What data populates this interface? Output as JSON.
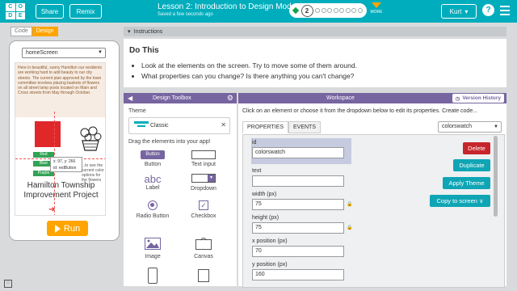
{
  "header": {
    "logo_letters": [
      "C",
      "O",
      "D",
      "E"
    ],
    "share_label": "Share",
    "remix_label": "Remix",
    "lesson_title": "Lesson 2: Introduction to Design Mode",
    "saved_text": "Saved a few seconds ago",
    "current_level": "2",
    "more_label": "MORE",
    "user_name": "Kurt",
    "user_chevron": "▾",
    "help_label": "?"
  },
  "left_panel": {
    "code_tab": "Code",
    "design_tab": "Design",
    "screen_select": "homeScreen",
    "intro_text": "Here in beautiful, sunny Hamilton our residents are working hard to add beauty to our city streets. The current plan approved by the town committee involves placing baskets of flowers on all street lamp posts located on Main and Cross streets from May through October.",
    "color_buttons": [
      "Red",
      "Blue",
      "Purple"
    ],
    "tooltip_line1": "x: 97, y: 266",
    "tooltip_line2": "id: redButton",
    "side_text": "...to see the current color options for the flowers",
    "hamilton_title": "Hamilton Township Improvement Project",
    "run_label": "Run"
  },
  "instructions": {
    "tab_label": "Instructions",
    "heading": "Do This",
    "bullets": [
      "Look at the elements on the screen. Try to move some of them around.",
      "What properties can you change? Is there anything you can't change?"
    ]
  },
  "toolbox": {
    "title": "Design Toolbox",
    "theme_label": "Theme",
    "theme_value": "Classic",
    "drag_label": "Drag the elements into your app!",
    "tools": {
      "button": "Button",
      "button_sample": "Button",
      "text_input": "Text input",
      "label": "Label",
      "label_sample": "abc",
      "dropdown": "Dropdown",
      "radio": "Radio Button",
      "checkbox": "Checkbox",
      "image": "Image",
      "canvas": "Canvas"
    }
  },
  "workspace": {
    "title": "Workspace",
    "version_history": "Version History",
    "hint": "Click on an element or choose it from the dropdown below to edit its properties. Create code...",
    "tab_properties": "PROPERTIES",
    "tab_events": "EVENTS",
    "element_select": "colorswatch",
    "props": {
      "id_label": "id",
      "id_value": "colorswatch",
      "text_label": "text",
      "text_value": "",
      "width_label": "width (px)",
      "width_value": "75",
      "height_label": "height (px)",
      "height_value": "75",
      "x_label": "x position (px)",
      "x_value": "70",
      "y_label": "y position (px)",
      "y_value": "160"
    },
    "delete_label": "Delete",
    "duplicate_label": "Duplicate",
    "apply_theme_label": "Apply Theme",
    "copy_label": "Copy to screen ∨"
  },
  "colors": {
    "header": "#00adbc",
    "accent": "#ffa400",
    "toolbox_header": "#7665a0",
    "delete": "#c6262b",
    "teal_button": "#0fa5b5"
  }
}
